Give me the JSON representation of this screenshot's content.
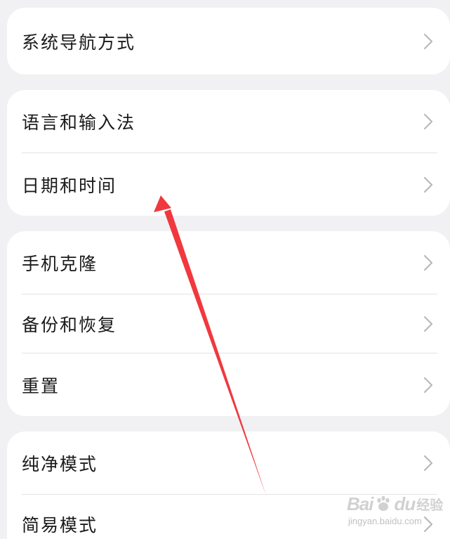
{
  "groups": [
    {
      "items": [
        {
          "label": "系统导航方式"
        }
      ]
    },
    {
      "items": [
        {
          "label": "语言和输入法"
        },
        {
          "label": "日期和时间"
        }
      ]
    },
    {
      "items": [
        {
          "label": "手机克隆"
        },
        {
          "label": "备份和恢复"
        },
        {
          "label": "重置"
        }
      ]
    },
    {
      "items": [
        {
          "label": "纯净模式"
        },
        {
          "label": "简易模式"
        }
      ]
    }
  ],
  "annotation": {
    "color": "#f0393e"
  },
  "watermark": {
    "brand": "Bai",
    "brand2": "du",
    "jingyan": "经验",
    "url": "jingyan.baidu.com"
  },
  "colors": {
    "background": "#f1f1f3",
    "card": "#ffffff",
    "text": "#1a1a1a",
    "chevron": "#b9b9bd",
    "divider": "#e3e3e5"
  }
}
